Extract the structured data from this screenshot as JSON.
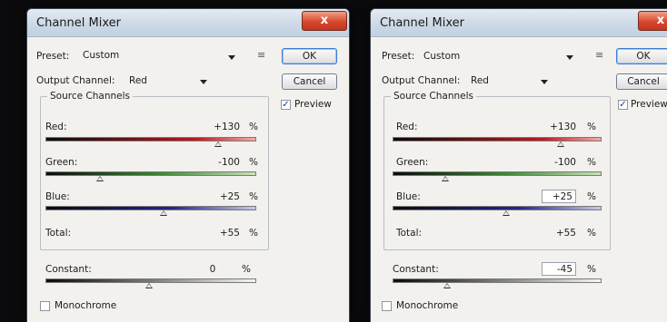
{
  "dialogs": [
    {
      "title": "Channel Mixer",
      "close_label": "x",
      "preset_label": "Preset:",
      "preset_value": "Custom",
      "ok_label": "OK",
      "cancel_label": "Cancel",
      "preview_label": "Preview",
      "preview_checked": true,
      "output_channel_label": "Output Channel:",
      "output_channel_value": "Red",
      "source_channels_title": "Source Channels",
      "channels": [
        {
          "label": "Red:",
          "value": "+130",
          "unit": "%"
        },
        {
          "label": "Green:",
          "value": "-100",
          "unit": "%"
        },
        {
          "label": "Blue:",
          "value": "+25",
          "unit": "%"
        }
      ],
      "total_label": "Total:",
      "total_value": "+55",
      "total_unit": "%",
      "constant_label": "Constant:",
      "constant_value": "0",
      "constant_unit": "%",
      "monochrome_label": "Monochrome",
      "monochrome_checked": false
    },
    {
      "title": "Channel Mixer",
      "close_label": "x",
      "preset_label": "Preset:",
      "preset_value": "Custom",
      "ok_label": "OK",
      "cancel_label": "Cancel",
      "preview_label": "Preview",
      "preview_checked": true,
      "output_channel_label": "Output Channel:",
      "output_channel_value": "Red",
      "source_channels_title": "Source Channels",
      "channels": [
        {
          "label": "Red:",
          "value": "+130",
          "unit": "%"
        },
        {
          "label": "Green:",
          "value": "-100",
          "unit": "%"
        },
        {
          "label": "Blue:",
          "value": "+25",
          "unit": "%"
        }
      ],
      "total_label": "Total:",
      "total_value": "+55",
      "total_unit": "%",
      "constant_label": "Constant:",
      "constant_value": "-45",
      "constant_unit": "%",
      "monochrome_label": "Monochrome",
      "monochrome_checked": false
    }
  ],
  "icons": {
    "preset_options": "presets-menu-icon",
    "dropdown": "chevron-down-icon",
    "check": "checkmark-icon"
  },
  "colors": {
    "red_channel": "#d2232a",
    "green_channel": "#3d8a35",
    "blue_channel": "#22238e",
    "close_button": "#d8482d",
    "default_button_border": "#3d7bd1"
  }
}
